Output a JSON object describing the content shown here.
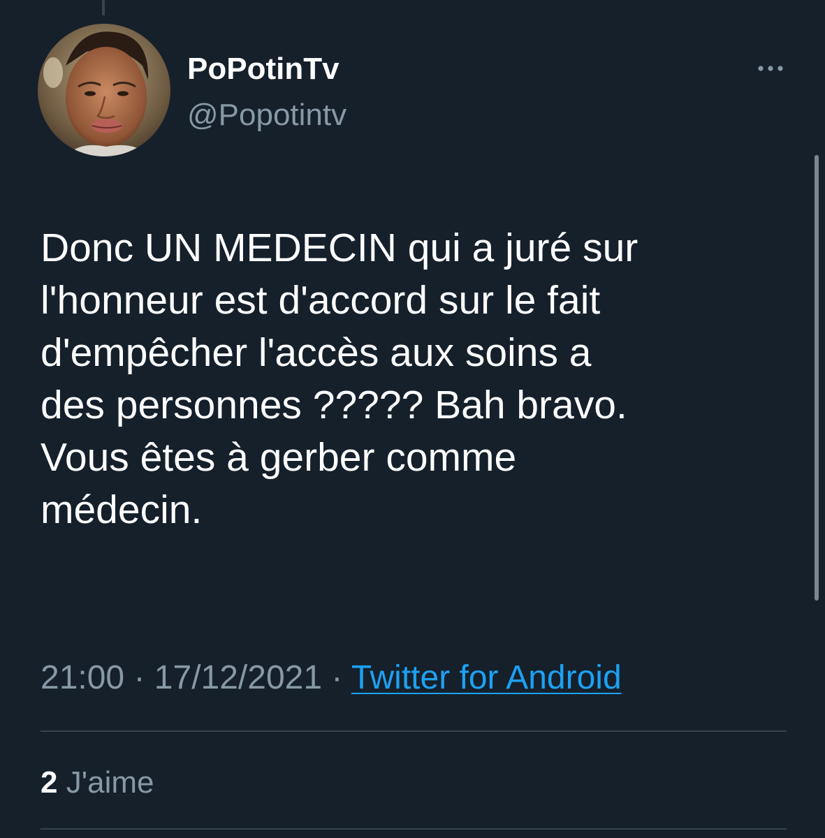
{
  "tweet": {
    "author": {
      "display_name": "PoPotinTv",
      "handle": "@Popotintv"
    },
    "text_lines": [
      "Donc UN MEDECIN qui a juré sur",
      "l'honneur est d'accord sur le fait",
      "d'empêcher l'accès aux soins a",
      "des personnes ????? Bah bravo.",
      "Vous êtes à gerber comme",
      "médecin."
    ],
    "time": "21:00",
    "separator": "·",
    "date": "17/12/2021",
    "source": "Twitter for Android",
    "likes": {
      "count": "2",
      "label": "J'aime"
    }
  },
  "icons": {
    "more": "more-horizontal-icon"
  },
  "colors": {
    "background": "#15202b",
    "primary_text": "#ffffff",
    "secondary_text": "#8899a6",
    "link": "#1da1f2",
    "divider": "#38444d"
  }
}
